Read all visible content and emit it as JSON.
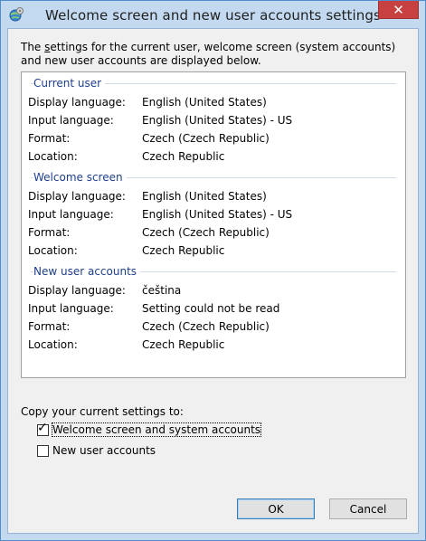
{
  "window": {
    "title": "Welcome screen and new user accounts settings",
    "close_symbol": "✕"
  },
  "intro": {
    "text_prefix": "The ",
    "text_underlined": "s",
    "text_rest": "ettings for the current user, welcome screen (system accounts) and new user accounts are displayed below."
  },
  "sections": [
    {
      "title": "Current user",
      "rows": [
        {
          "label": "Display language:",
          "value": "English (United States)"
        },
        {
          "label": "Input language:",
          "value": "English (United States) - US"
        },
        {
          "label": "Format:",
          "value": "Czech (Czech Republic)"
        },
        {
          "label": "Location:",
          "value": "Czech Republic"
        }
      ]
    },
    {
      "title": "Welcome screen",
      "rows": [
        {
          "label": "Display language:",
          "value": "English (United States)"
        },
        {
          "label": "Input language:",
          "value": "English (United States) - US"
        },
        {
          "label": "Format:",
          "value": "Czech (Czech Republic)"
        },
        {
          "label": "Location:",
          "value": "Czech Republic"
        }
      ]
    },
    {
      "title": "New user accounts",
      "rows": [
        {
          "label": "Display language:",
          "value": "čeština"
        },
        {
          "label": "Input language:",
          "value": "Setting could not be read"
        },
        {
          "label": "Format:",
          "value": "Czech (Czech Republic)"
        },
        {
          "label": "Location:",
          "value": "Czech Republic"
        }
      ]
    }
  ],
  "copy": {
    "label": "Copy your current settings to:",
    "welcome_label": "Welcome screen and system accounts",
    "welcome_checked": true,
    "new_users_label": "New user accounts",
    "new_users_checked": false
  },
  "buttons": {
    "ok": "OK",
    "cancel": "Cancel"
  },
  "colors": {
    "section_header": "#1e3f8c",
    "title_bar": "#c2d9f0",
    "close_button": "#c74141"
  }
}
